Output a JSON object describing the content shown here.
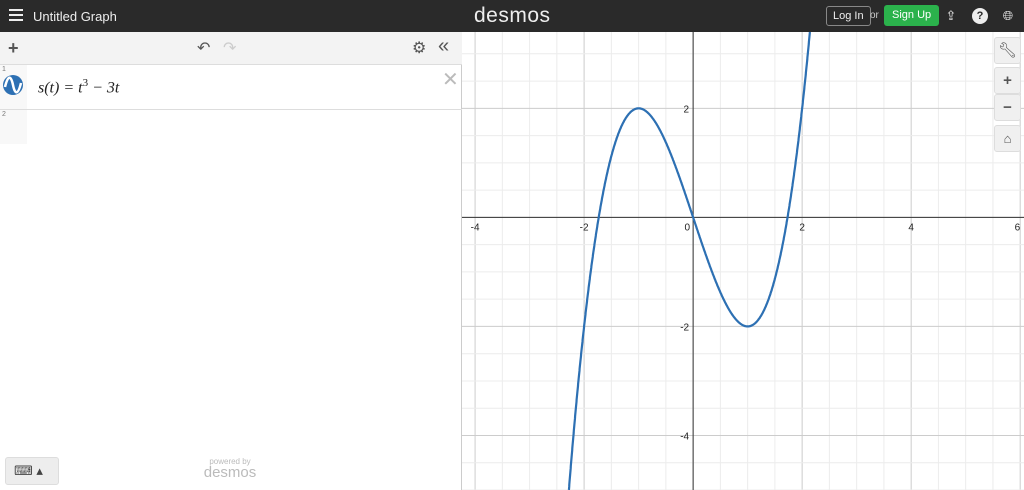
{
  "header": {
    "title": "Untitled Graph",
    "logo": "desmos",
    "login": "Log In",
    "or": "or",
    "signup": "Sign Up"
  },
  "expressions": [
    {
      "index": "1",
      "latex_parts": {
        "lhs": "s(t) = t",
        "exp": "3",
        "rhs": " − 3t"
      },
      "color": "#2d70b3"
    },
    {
      "index": "2"
    }
  ],
  "footer": {
    "powered": "powered by",
    "brand": "desmos"
  },
  "chart_data": {
    "type": "line",
    "function": "s(t)=t^3-3t",
    "xlim": [
      -4.24,
      6.07
    ],
    "ylim": [
      -5.0,
      3.4
    ],
    "grid": true,
    "x_ticks": [
      "-4",
      "-2",
      "0",
      "2",
      "4",
      "6"
    ],
    "y_ticks": [
      "2",
      "-2",
      "-4"
    ],
    "series": [
      {
        "name": "s(t)",
        "color": "#2d70b3"
      }
    ]
  }
}
